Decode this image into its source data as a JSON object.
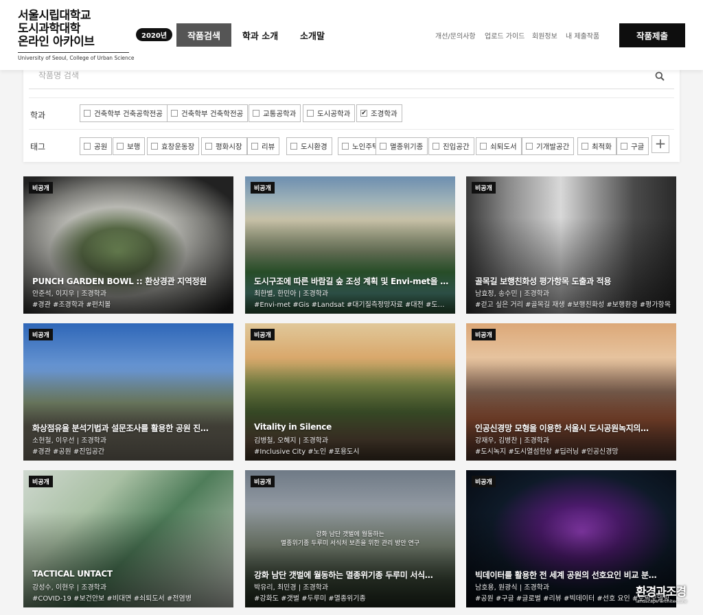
{
  "header": {
    "logo_lines": [
      "서울시립대학교",
      "도시과학대학",
      "온라인 아카이브"
    ],
    "logo_sub": "University of Seoul, College of Urban Science",
    "year_badge": "2020년",
    "nav": [
      "작품검색",
      "학과 소개",
      "소개말"
    ],
    "util_links": [
      "개선/문의사항",
      "업로드 가이드",
      "회원정보",
      "내 제출작품"
    ],
    "submit_label": "작품제출"
  },
  "filters": {
    "search_placeholder": "작품명 검색",
    "dept_label": "학과",
    "departments": [
      {
        "label": "건축학부 건축공학전공",
        "checked": false
      },
      {
        "label": "건축학부 건축학전공",
        "checked": false
      },
      {
        "label": "교통공학과",
        "checked": false
      },
      {
        "label": "도시공학과",
        "checked": false
      },
      {
        "label": "조경학과",
        "checked": true
      }
    ],
    "tag_label": "태그",
    "tags": [
      "공원",
      "보행",
      "효창운동장",
      "평화시장",
      "리뷰",
      "도시환경",
      "노인주택",
      "멸종위기종",
      "진입공간",
      "쇠퇴도서",
      "기개발공간",
      "최적화",
      "구글"
    ],
    "more_label": "+"
  },
  "cards": [
    {
      "badge": "비공개",
      "title": "PUNCH GARDEN BOWL :: 환상경관 지역정원",
      "authors": "안준석, 이지우 | 조경학과",
      "tags": "#경관 #조경학과 #펀치볼",
      "caption": ""
    },
    {
      "badge": "비공개",
      "title": "도시구조에 따른 바람길 숲 조성 계획 및 Envi-met을 …",
      "authors": "최한별, 한민아 | 조경학과",
      "tags": "#Envi-met #Gis #Landsat #대기질측정망자료 #대전 #도시구조 #…",
      "caption": ""
    },
    {
      "badge": "비공개",
      "title": "골목길 보행친화성 평가항목 도출과 적용",
      "authors": "남효정, 송수민 | 조경학과",
      "tags": "#걷고 싶은 거리 #골목길 재생 #보행친화성 #보행환경 #평가항목",
      "caption": ""
    },
    {
      "badge": "비공개",
      "title": "화상점유율 분석기법과 설문조사를 활용한 공원 진…",
      "authors": "소현철, 이우선 | 조경학과",
      "tags": "#경관 #공원 #진입공간",
      "caption": ""
    },
    {
      "badge": "비공개",
      "title": "Vitality in Silence",
      "authors": "김병철, 오혜지 | 조경학과",
      "tags": "#Inclusive City #노인 #포용도시",
      "caption": ""
    },
    {
      "badge": "비공개",
      "title": "인공신경망 모형을 이용한 서울시 도시공원녹지의…",
      "authors": "강재우, 김병찬 | 조경학과",
      "tags": "#도시녹지 #도시열섬현상 #딥러닝 #인공신경망",
      "caption": ""
    },
    {
      "badge": "비공개",
      "title": "TACTICAL UNTACT",
      "authors": "강성수, 이현우 | 조경학과",
      "tags": "#COVID-19 #보건안보 #비대면 #쇠퇴도서 #전염병",
      "caption": ""
    },
    {
      "badge": "비공개",
      "title": "강화 남단 갯벌에 월동하는 멸종위기종 두루미 서식…",
      "authors": "박유리, 최민경 | 조경학과",
      "tags": "#강화도 #갯벌 #두루미 #멸종위기종",
      "caption": "강화 남단 갯벌에 월동하는\n멸종위기종 두루미 서식처 보존을 위한 관리 방안 연구"
    },
    {
      "badge": "비공개",
      "title": "빅데이터를 활용한 전 세계 공원의 선호요인 비교 분…",
      "authors": "남호용, 원광식 | 조경학과",
      "tags": "#공원 #구글 #글로벌 #리뷰 #빅데이터 #선호 요인 #토픽모델링",
      "caption": ""
    }
  ],
  "watermark": {
    "main": "환경과조경",
    "sub": "landscape architecture"
  }
}
